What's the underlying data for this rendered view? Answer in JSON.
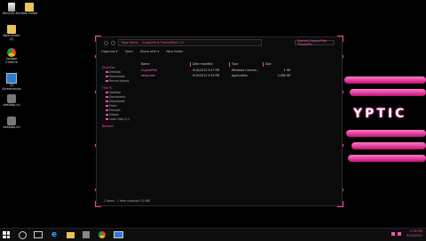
{
  "desktop": {
    "icons": [
      {
        "label": "Recycle Bin"
      },
      {
        "label": "New folder"
      },
      {
        "label": "New folder (2)"
      },
      {
        "label": "Google Chrome"
      },
      {
        "label": "25 Screenshots"
      },
      {
        "label": "desktop.ini"
      },
      {
        "label": "desktop.ini"
      }
    ]
  },
  "explorer": {
    "address": {
      "segments": [
        "New folder",
        "CrypticPink ThemePack 1.0"
      ]
    },
    "search_placeholder": "Search CrypticPink ThemePa...",
    "toolbar": {
      "organize": "Organize ▾",
      "open": "Open",
      "share": "Share with ▾",
      "new_folder": "New folder"
    },
    "sidebar": {
      "favorites": "Favorites",
      "fav_items": [
        "Desktop",
        "Downloads",
        "Recent places"
      ],
      "this_pc": "This PC",
      "pc_items": [
        "Desktop",
        "Documents",
        "Downloads",
        "Music",
        "Pictures",
        "Videos",
        "Local Disk (C:)"
      ],
      "network": "Network"
    },
    "columns": {
      "name": "Name",
      "date": "Date modified",
      "type": "Type",
      "size": "Size"
    },
    "files": [
      {
        "name": "CrypticPink",
        "date": "9/10/2015 5:47 PM",
        "type": "Windows Comma...",
        "size": "1 KB"
      },
      {
        "name": "setup.exe",
        "date": "9/10/2015 5:55 PM",
        "type": "Application",
        "size": "3,068 KB"
      }
    ],
    "status": {
      "count": "2 items",
      "selected": "1 item selected 3.0 MB"
    }
  },
  "art": {
    "text": "YPTIC",
    "accent": "#ff3ca8"
  },
  "taskbar": {
    "time": "1:36 PM",
    "date": "9/10/2015"
  }
}
